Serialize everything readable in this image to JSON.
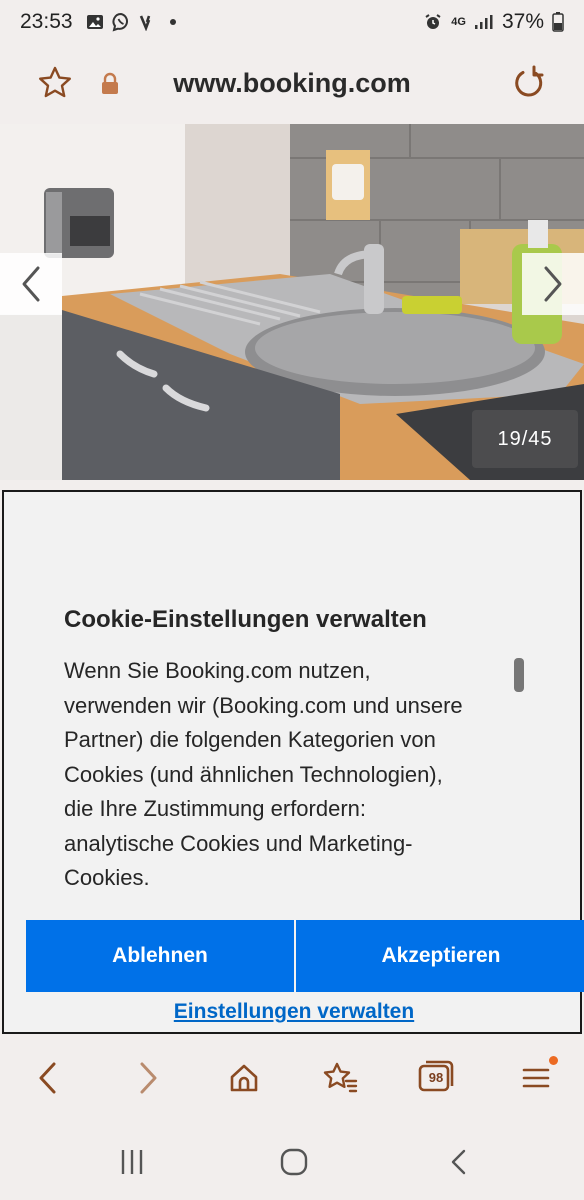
{
  "status_bar": {
    "time": "23:53",
    "network": "4G",
    "battery": "37%"
  },
  "address_bar": {
    "url": "www.booking.com",
    "icons": [
      "star-icon",
      "lock-icon",
      "reload-icon"
    ]
  },
  "gallery": {
    "counter": "19/45"
  },
  "cookie_dialog": {
    "title": "Cookie-Einstellungen verwalten",
    "body_lines": [
      "Wenn Sie Booking.com nutzen,",
      "verwenden wir (Booking.com und unsere",
      "Partner) die folgenden Kategorien von",
      "Cookies (und ähnlichen Technologien),",
      "die Ihre Zustimmung erfordern:",
      "analytische Cookies und Marketing-",
      "Cookies."
    ],
    "reject_label": "Ablehnen",
    "accept_label": "Akzeptieren",
    "manage_label": "Einstellungen verwalten"
  },
  "toolbar": {
    "tabs_count": "98",
    "icons": [
      "back-icon",
      "forward-icon",
      "home-icon",
      "bookmarks-icon",
      "tabs-icon",
      "menu-icon"
    ]
  },
  "colors": {
    "accent_brown": "#8a4a22",
    "button_blue": "#0071e8",
    "link_blue": "#0067c7",
    "notification_orange": "#ec6a23"
  }
}
